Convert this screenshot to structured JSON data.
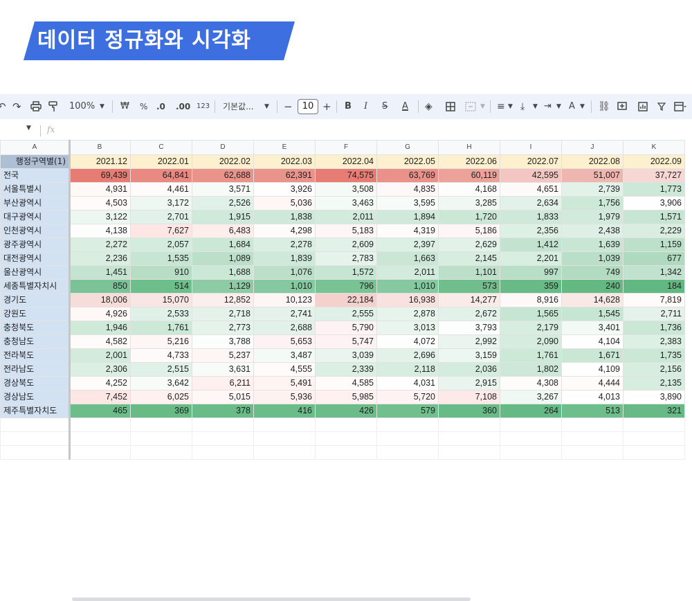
{
  "banner": {
    "title": "데이터 정규화와 시각화",
    "color": "#3d6fe0"
  },
  "toolbar": {
    "zoom": "100%",
    "currency": "₩",
    "percent": "%",
    "dec_decrease": ".0",
    "dec_increase": ".00",
    "number_format": "123",
    "font_name": "기본값...",
    "font_size": "10",
    "bold": "B",
    "italic": "I",
    "strike": "S",
    "text_color": "A",
    "text_rotate": "A"
  },
  "formula": {
    "fx": "fx"
  },
  "columns": [
    "A",
    "B",
    "C",
    "D",
    "E",
    "F",
    "G",
    "H",
    "I",
    "J",
    "K"
  ],
  "header_label": "행정구역별(1)",
  "months": [
    "2021.12",
    "2022.01",
    "2022.02",
    "2022.03",
    "2022.04",
    "2022.05",
    "2022.06",
    "2022.07",
    "2022.08",
    "2022.09"
  ],
  "rows": [
    {
      "region": "전국",
      "values": [
        "69,439",
        "64,841",
        "62,688",
        "62,391",
        "74,575",
        "63,769",
        "60,119",
        "42,595",
        "51,007",
        "37,727"
      ],
      "colors": [
        "#e67c73",
        "#e88a81",
        "#ea938a",
        "#ea938a",
        "#e67c73",
        "#ea928a",
        "#eca199",
        "#f3c6c1",
        "#efb5af",
        "#f6d7d4"
      ]
    },
    {
      "region": "서울특별시",
      "values": [
        "4,931",
        "4,461",
        "3,571",
        "3,926",
        "3,508",
        "4,835",
        "4,168",
        "4,651",
        "2,739",
        "1,773"
      ],
      "colors": [
        "#fef8f7",
        "#fefbfa",
        "#f6fbf8",
        "#fefefe",
        "#f5faf7",
        "#fef9f8",
        "#fefdfd",
        "#fefaf9",
        "#e3f2e9",
        "#cce8d7"
      ]
    },
    {
      "region": "부산광역시",
      "values": [
        "4,503",
        "3,172",
        "2,526",
        "5,036",
        "3,463",
        "3,595",
        "3,285",
        "2,634",
        "1,756",
        "3,906"
      ],
      "colors": [
        "#fefbfa",
        "#eef7f2",
        "#e0f1e7",
        "#fef7f6",
        "#f4faf6",
        "#f7fbf9",
        "#f1f8f4",
        "#e2f2e8",
        "#cce8d7",
        "#fefefe"
      ]
    },
    {
      "region": "대구광역시",
      "values": [
        "3,122",
        "2,701",
        "1,915",
        "1,838",
        "2,011",
        "1,894",
        "1,720",
        "1,833",
        "1,979",
        "1,571"
      ],
      "colors": [
        "#edf7f1",
        "#e3f2e9",
        "#cfe9da",
        "#cee9d9",
        "#d2ebdc",
        "#cfe9da",
        "#cbe7d6",
        "#cee9d9",
        "#d1eadb",
        "#c7e5d3"
      ]
    },
    {
      "region": "인천광역시",
      "values": [
        "4,138",
        "7,627",
        "6,483",
        "4,298",
        "5,183",
        "4,319",
        "5,186",
        "2,356",
        "2,438",
        "2,229"
      ],
      "colors": [
        "#fefdfd",
        "#fde6e4",
        "#fdedeb",
        "#fefcfb",
        "#fef6f5",
        "#fefcfb",
        "#fef6f5",
        "#ddf0e4",
        "#def0e5",
        "#d9eee1"
      ]
    },
    {
      "region": "광주광역시",
      "values": [
        "2,272",
        "2,057",
        "1,684",
        "2,278",
        "2,609",
        "2,397",
        "2,629",
        "1,412",
        "1,639",
        "1,159"
      ],
      "colors": [
        "#daeee2",
        "#d4ecde",
        "#cbe7d6",
        "#daeee2",
        "#e2f2e8",
        "#ddf0e4",
        "#e2f2e8",
        "#c3e3d0",
        "#c9e6d5",
        "#bde0cb"
      ]
    },
    {
      "region": "대전광역시",
      "values": [
        "2,236",
        "1,535",
        "1,089",
        "1,839",
        "2,783",
        "1,663",
        "2,145",
        "2,201",
        "1,039",
        "677"
      ],
      "colors": [
        "#d9eee1",
        "#c6e5d2",
        "#bbdfc9",
        "#cee9d9",
        "#e6f3eb",
        "#cae7d5",
        "#d6ede0",
        "#d8eee1",
        "#badfc8",
        "#b0dac0"
      ]
    },
    {
      "region": "울산광역시",
      "values": [
        "1,451",
        "910",
        "1,688",
        "1,076",
        "1,572",
        "2,011",
        "1,101",
        "997",
        "749",
        "1,342"
      ],
      "colors": [
        "#c4e3d0",
        "#b7ddc5",
        "#cbe7d6",
        "#bbdfc9",
        "#c7e5d3",
        "#d2ebdc",
        "#bbdfc9",
        "#b9dec7",
        "#b2dbc1",
        "#c1e2ce"
      ]
    },
    {
      "region": "세종특별자치시",
      "values": [
        "850",
        "514",
        "1,129",
        "1,010",
        "796",
        "1,010",
        "573",
        "359",
        "240",
        "184"
      ],
      "colors": [
        "#7bc396",
        "#6ebe8b",
        "#8ccba3",
        "#86c89f",
        "#78c293",
        "#86c89f",
        "#6fbe8c",
        "#68bb86",
        "#64b983",
        "#62b881"
      ]
    },
    {
      "region": "경기도",
      "values": [
        "18,006",
        "15,070",
        "12,852",
        "10,123",
        "22,184",
        "16,938",
        "14,277",
        "8,916",
        "14,628",
        "7,819"
      ],
      "colors": [
        "#f7ddda",
        "#f9e6e4",
        "#fbeeec",
        "#fdf6f5",
        "#f5d1cd",
        "#f8e1de",
        "#faeae8",
        "#fef9f8",
        "#f9e9e6",
        "#fefbfa"
      ]
    },
    {
      "region": "강원도",
      "values": [
        "4,926",
        "2,533",
        "2,718",
        "2,741",
        "2,555",
        "2,878",
        "2,672",
        "1,565",
        "1,545",
        "2,711"
      ],
      "colors": [
        "#fef8f7",
        "#e0f1e7",
        "#e4f2ea",
        "#e4f2ea",
        "#e0f1e7",
        "#e7f4ec",
        "#e3f2e9",
        "#c7e5d3",
        "#c6e5d2",
        "#e4f2ea"
      ]
    },
    {
      "region": "충청북도",
      "values": [
        "1,946",
        "1,761",
        "2,773",
        "2,688",
        "5,790",
        "3,013",
        "3,793",
        "2,179",
        "3,401",
        "1,736"
      ],
      "colors": [
        "#d0eada",
        "#cce8d7",
        "#e5f3eb",
        "#e3f2e9",
        "#fef3f2",
        "#e9f5ee",
        "#fcfefd",
        "#d7eddf",
        "#f3f9f5",
        "#cbe7d6"
      ]
    },
    {
      "region": "충청남도",
      "values": [
        "4,582",
        "5,216",
        "3,788",
        "5,653",
        "5,747",
        "4,072",
        "2,992",
        "2,090",
        "4,104",
        "2,383"
      ],
      "colors": [
        "#fefbfa",
        "#fef6f5",
        "#fcfefd",
        "#fef3f2",
        "#fef3f2",
        "#fefefe",
        "#e9f5ee",
        "#d5ecde",
        "#fefefe",
        "#ddf0e4"
      ]
    },
    {
      "region": "전라북도",
      "values": [
        "2,001",
        "4,733",
        "5,237",
        "3,487",
        "3,039",
        "2,696",
        "3,159",
        "1,761",
        "1,671",
        "1,735"
      ],
      "colors": [
        "#d2ebdc",
        "#fefaf9",
        "#fef6f5",
        "#f4faf6",
        "#eaf5ef",
        "#e3f2e9",
        "#edf7f1",
        "#cce8d7",
        "#cae7d5",
        "#cbe7d6"
      ]
    },
    {
      "region": "전라남도",
      "values": [
        "2,306",
        "2,515",
        "3,631",
        "4,555",
        "2,339",
        "2,118",
        "2,036",
        "1,802",
        "4,109",
        "2,156"
      ],
      "colors": [
        "#dcefe3",
        "#e0f1e7",
        "#f8fcf9",
        "#fefbfa",
        "#dcefe3",
        "#d6ede0",
        "#d4ecde",
        "#cde8d8",
        "#fefefe",
        "#d6ede0"
      ]
    },
    {
      "region": "경상북도",
      "values": [
        "4,252",
        "3,642",
        "6,211",
        "5,491",
        "4,585",
        "4,031",
        "2,915",
        "4,308",
        "4,444",
        "2,135"
      ],
      "colors": [
        "#fefcfb",
        "#f8fcf9",
        "#fef0ee",
        "#fef5f3",
        "#fefbfa",
        "#fefefe",
        "#e8f4ed",
        "#fefcfb",
        "#fefbfa",
        "#d6ede0"
      ]
    },
    {
      "region": "경상남도",
      "values": [
        "7,452",
        "6,025",
        "5,015",
        "5,936",
        "5,985",
        "5,720",
        "7,108",
        "3,267",
        "4,013",
        "3,890"
      ],
      "colors": [
        "#fde7e5",
        "#fef1ef",
        "#fef7f6",
        "#fef2f0",
        "#fef1ef",
        "#fef3f2",
        "#fde9e7",
        "#f0f8f3",
        "#fefefe",
        "#fdfefd"
      ]
    },
    {
      "region": "제주특별자치도",
      "values": [
        "465",
        "369",
        "378",
        "416",
        "426",
        "579",
        "360",
        "264",
        "513",
        "321"
      ],
      "colors": [
        "#6cbd89",
        "#69bb86",
        "#69bb87",
        "#6abc88",
        "#6bbc88",
        "#70bf8d",
        "#68bb86",
        "#65b984",
        "#6ebe8b",
        "#67ba85"
      ]
    }
  ]
}
